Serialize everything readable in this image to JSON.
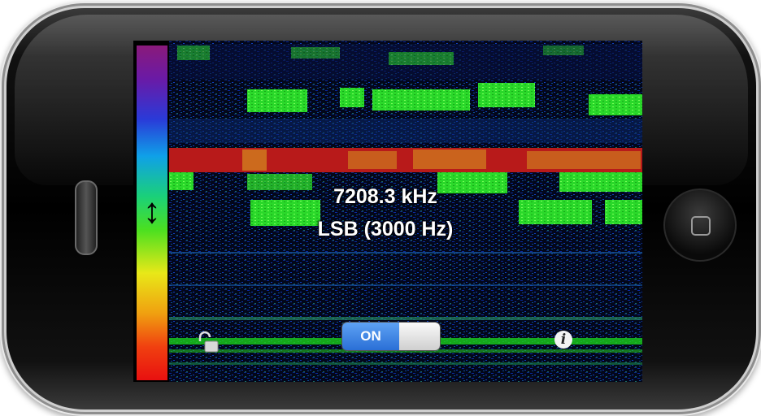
{
  "device": {
    "speaker_icon": "speaker-grille-icon",
    "home_icon": "home-button-icon"
  },
  "display": {
    "frequency": "7208.3 kHz",
    "mode": "LSB (3000 Hz)"
  },
  "controls": {
    "lock_icon": "unlocked-padlock-icon",
    "toggle_label": "ON",
    "toggle_state": "on",
    "info_glyph": "i",
    "zoom_icon": "vertical-double-arrow-icon"
  },
  "colors": {
    "toggle_on": "#2a6fd6",
    "signal_band": "#c81e1e",
    "signal_strong": "#3ce83c",
    "noise": "#0a2a8a"
  }
}
